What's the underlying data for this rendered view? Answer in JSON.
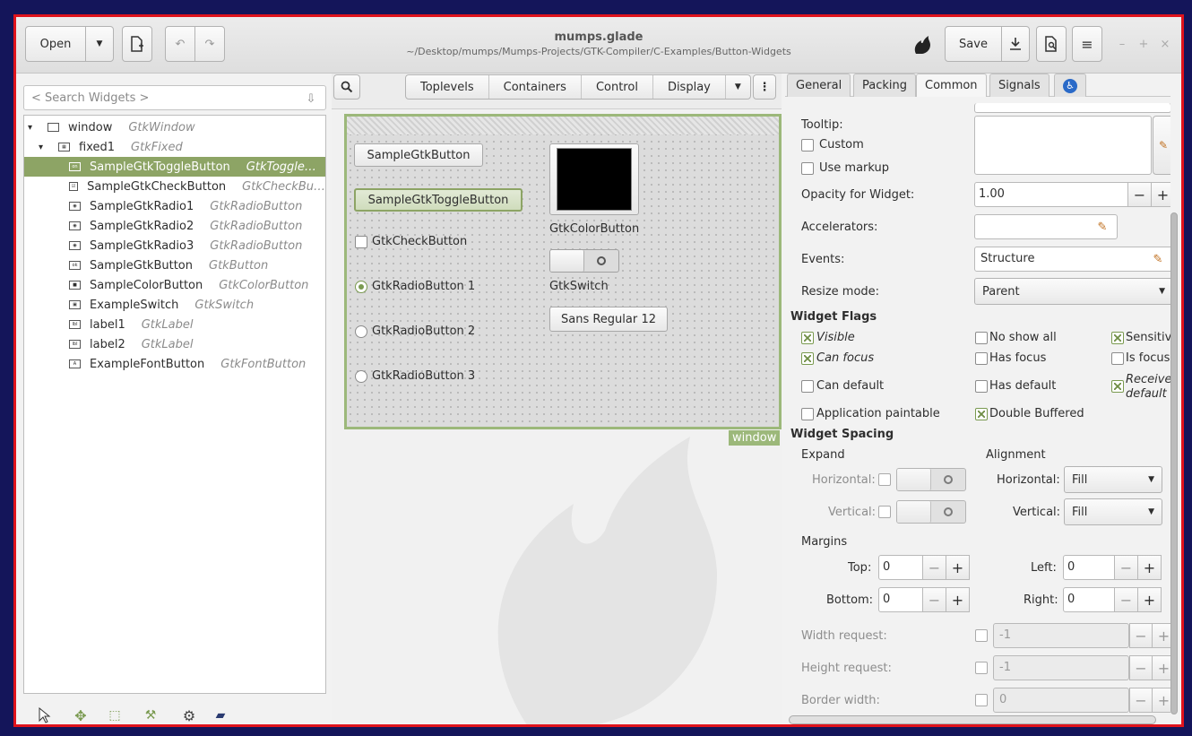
{
  "colors": {
    "border_red": "#e0131c",
    "background": "#14155a",
    "selection": "#8da465",
    "window_frame": "#9cb87a"
  },
  "header": {
    "open_label": "Open",
    "title": "mumps.glade",
    "subtitle": "~/Desktop/mumps/Mumps-Projects/GTK-Compiler/C-Examples/Button-Widgets",
    "save_label": "Save",
    "icons": [
      "new-file-icon",
      "undo-icon",
      "redo-icon",
      "glade-logo-icon",
      "export-icon",
      "preview-icon",
      "menu-icon"
    ]
  },
  "palette": {
    "search_placeholder": "< Search Widgets >"
  },
  "tree": [
    {
      "name": "window",
      "type": "GtkWindow",
      "depth": 0,
      "expander": "▾",
      "icon": "window-icon"
    },
    {
      "name": "fixed1",
      "type": "GtkFixed",
      "depth": 1,
      "expander": "▾",
      "icon": "fixed-icon"
    },
    {
      "name": "SampleGtkToggleButton",
      "type": "GtkToggle…",
      "depth": 2,
      "icon": "toggle-icon",
      "selected": true
    },
    {
      "name": "SampleGtkCheckButton",
      "type": "GtkCheckBu…",
      "depth": 2,
      "icon": "check-icon"
    },
    {
      "name": "SampleGtkRadio1",
      "type": "GtkRadioButton",
      "depth": 2,
      "icon": "radio-icon"
    },
    {
      "name": "SampleGtkRadio2",
      "type": "GtkRadioButton",
      "depth": 2,
      "icon": "radio-icon"
    },
    {
      "name": "SampleGtkRadio3",
      "type": "GtkRadioButton",
      "depth": 2,
      "icon": "radio-icon"
    },
    {
      "name": "SampleGtkButton",
      "type": "GtkButton",
      "depth": 2,
      "icon": "button-icon"
    },
    {
      "name": "SampleColorButton",
      "type": "GtkColorButton",
      "depth": 2,
      "icon": "color-icon"
    },
    {
      "name": "ExampleSwitch",
      "type": "GtkSwitch",
      "depth": 2,
      "icon": "switch-icon"
    },
    {
      "name": "label1",
      "type": "GtkLabel",
      "depth": 2,
      "icon": "label-icon"
    },
    {
      "name": "label2",
      "type": "GtkLabel",
      "depth": 2,
      "icon": "label-icon"
    },
    {
      "name": "ExampleFontButton",
      "type": "GtkFontButton",
      "depth": 2,
      "icon": "font-icon"
    }
  ],
  "center": {
    "tabs": [
      "Toplevels",
      "Containers",
      "Control",
      "Display"
    ],
    "window_label": "window",
    "widgets": {
      "button": "SampleGtkButton",
      "toggle": "SampleGtkToggleButton",
      "check": "GtkCheckButton",
      "radio1": "GtkRadioButton 1",
      "radio2": "GtkRadioButton 2",
      "radio3": "GtkRadioButton 3",
      "color_label": "GtkColorButton",
      "switch_label": "GtkSwitch",
      "font_name": "Sans Regular",
      "font_size": "12"
    }
  },
  "props": {
    "tabs": [
      "General",
      "Packing",
      "Common",
      "Signals"
    ],
    "active_tab": "Common",
    "tooltip": "Tooltip:",
    "custom": "Custom",
    "use_markup": "Use markup",
    "opacity_label": "Opacity for Widget:",
    "opacity_value": "1.00",
    "accelerators": "Accelerators:",
    "events_label": "Events:",
    "events_value": "Structure",
    "resize_label": "Resize mode:",
    "resize_value": "Parent",
    "flags_heading": "Widget Flags",
    "flags": {
      "visible": "Visible",
      "no_show_all": "No show all",
      "sensitive": "Sensitiv",
      "can_focus": "Can focus",
      "has_focus": "Has focus",
      "is_focus": "Is focus",
      "can_default": "Can default",
      "has_default": "Has default",
      "receives_default": "Receives default",
      "app_paintable": "Application paintable",
      "double_buffered": "Double Buffered"
    },
    "spacing_heading": "Widget Spacing",
    "expand": "Expand",
    "alignment": "Alignment",
    "horizontal": "Horizontal:",
    "vertical": "Vertical:",
    "fill": "Fill",
    "margins": "Margins",
    "top": "Top:",
    "bottom": "Bottom:",
    "left": "Left:",
    "right": "Right:",
    "margin_value": "0",
    "width_request": "Width request:",
    "height_request": "Height request:",
    "border_width": "Border width:",
    "request_value": "-1",
    "border_value": "0"
  }
}
